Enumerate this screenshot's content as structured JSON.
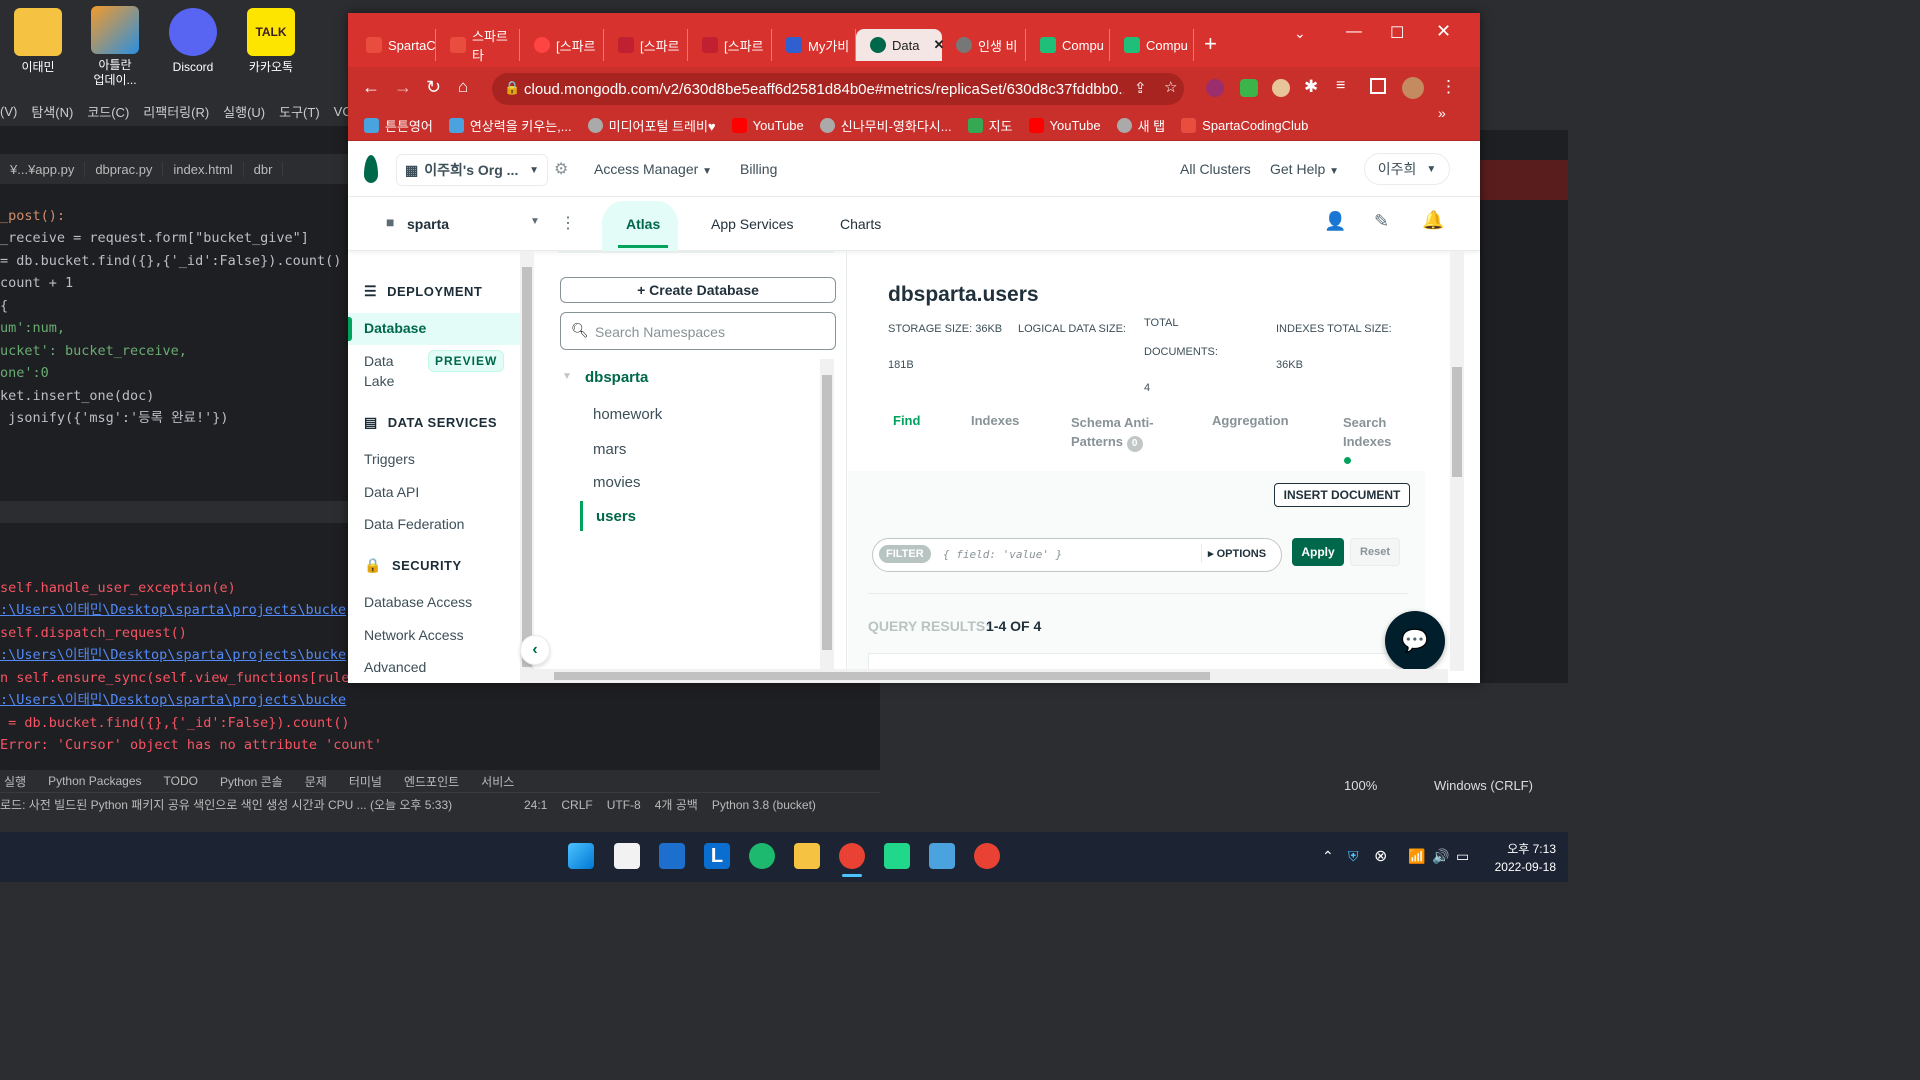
{
  "desktop": {
    "icons": [
      {
        "label": "이태민"
      },
      {
        "label": "아틀란\n업데이..."
      },
      {
        "label": "Discord"
      },
      {
        "label": "카카오톡"
      }
    ]
  },
  "ide": {
    "menu": [
      "(V)",
      "탐색(N)",
      "코드(C)",
      "리팩터링(R)",
      "실행(U)",
      "도구(T)",
      "VCS"
    ],
    "tabs": [
      "¥...¥app.py",
      "dbprac.py",
      "index.html",
      "dbr"
    ],
    "code": [
      "_post():",
      "_receive = request.form[\"bucket_give\"]",
      "",
      "= db.bucket.find({},{'_id':False}).count()",
      "count + 1",
      "",
      "{",
      "um':num,",
      "ucket': bucket_receive,",
      "one':0",
      "",
      "",
      "ket.insert_one(doc)",
      " jsonify({'msg':'등록 완료!'})"
    ],
    "run_output": [
      "self.handle_user_exception(e)",
      ":\\Users\\이태민\\Desktop\\sparta\\projects\\bucke",
      "self.dispatch_request()",
      ":\\Users\\이태민\\Desktop\\sparta\\projects\\bucke",
      "n self.ensure_sync(self.view_functions[rule",
      ":\\Users\\이태민\\Desktop\\sparta\\projects\\bucke",
      " = db.bucket.find({},{'_id':False}).count()",
      "Error: 'Cursor' object has no attribute 'count'"
    ],
    "tool_windows": [
      "실행",
      "Python Packages",
      "TODO",
      "Python 콘솔",
      "문제",
      "터미널",
      "엔드포인트",
      "서비스"
    ],
    "status_message": "로드: 사전 빌드된 Python 패키지 공유 색인으로 색인 생성 시간과 CPU ... (오늘 오후 5:33)",
    "status_items": [
      "24:1",
      "CRLF",
      "UTF-8",
      "4개 공백",
      "Python 3.8 (bucket)"
    ]
  },
  "right_app": {
    "zoom": "100%",
    "eol": "Windows (CRLF)"
  },
  "browser": {
    "tabs": [
      {
        "label": "SpartaC"
      },
      {
        "label": "스파르타"
      },
      {
        "label": "[스파르"
      },
      {
        "label": "[스파르"
      },
      {
        "label": "[스파르"
      },
      {
        "label": "My가비"
      },
      {
        "label": "Data",
        "active": true
      },
      {
        "label": "인생 비"
      },
      {
        "label": "Compu"
      },
      {
        "label": "Compu"
      }
    ],
    "url": "cloud.mongodb.com/v2/630d8be5eaff6d2581d84b0e#metrics/replicaSet/630d8c37fddbb0...",
    "bookmarks": [
      "튼튼영어",
      "연상력을 키우는,...",
      "미디어포털 트레비♥",
      "YouTube",
      "신나무비-영화다시...",
      "지도",
      "YouTube",
      "새 탭",
      "SpartaCodingClub"
    ]
  },
  "atlas": {
    "org_name": "이주희's Org ...",
    "access_manager": "Access Manager",
    "billing": "Billing",
    "all_clusters": "All Clusters",
    "get_help": "Get Help",
    "user": "이주희",
    "project": "sparta",
    "project_tabs": [
      "Atlas",
      "App Services",
      "Charts"
    ],
    "sidebar": {
      "deployment": "DEPLOYMENT",
      "database": "Database",
      "data_lake_1": "Data",
      "data_lake_2": "Lake",
      "preview": "PREVIEW",
      "data_services": "DATA SERVICES",
      "triggers": "Triggers",
      "data_api": "Data API",
      "data_federation": "Data Federation",
      "security": "SECURITY",
      "database_access": "Database Access",
      "network_access": "Network Access",
      "advanced": "Advanced"
    },
    "create_database": "Create Database",
    "search_placeholder": "Search Namespaces",
    "db_name": "dbsparta",
    "collections": [
      "homework",
      "mars",
      "movies",
      "users"
    ],
    "collection_title": "dbsparta.users",
    "stats": {
      "storage_label": "STORAGE SIZE:",
      "storage_value": "36KB",
      "logical_label": "LOGICAL DATA SIZE:",
      "logical_value": "181B",
      "docs_label_1": "TOTAL",
      "docs_label_2": "DOCUMENTS:",
      "docs_value": "4",
      "indexes_label": "INDEXES TOTAL SIZE:",
      "indexes_value": "36KB"
    },
    "coll_tabs": {
      "find": "Find",
      "indexes": "Indexes",
      "schema_1": "Schema Anti-",
      "schema_2": "Patterns",
      "schema_count": "0",
      "aggregation": "Aggregation",
      "search_1": "Search",
      "search_2": "Indexes"
    },
    "insert_document": "INSERT DOCUMENT",
    "filter_label": "FILTER",
    "filter_placeholder": "{ field: 'value' }",
    "options": "OPTIONS",
    "apply": "Apply",
    "reset": "Reset",
    "query_results_label": "QUERY RESULTS:",
    "query_results_value": "1-4 OF 4"
  },
  "taskbar": {
    "time": "오후 7:13",
    "date": "2022-09-18"
  },
  "colors": {
    "mongo_green": "#00684a",
    "browser_red": "#d8322e",
    "taskbar": "#1c2433"
  }
}
